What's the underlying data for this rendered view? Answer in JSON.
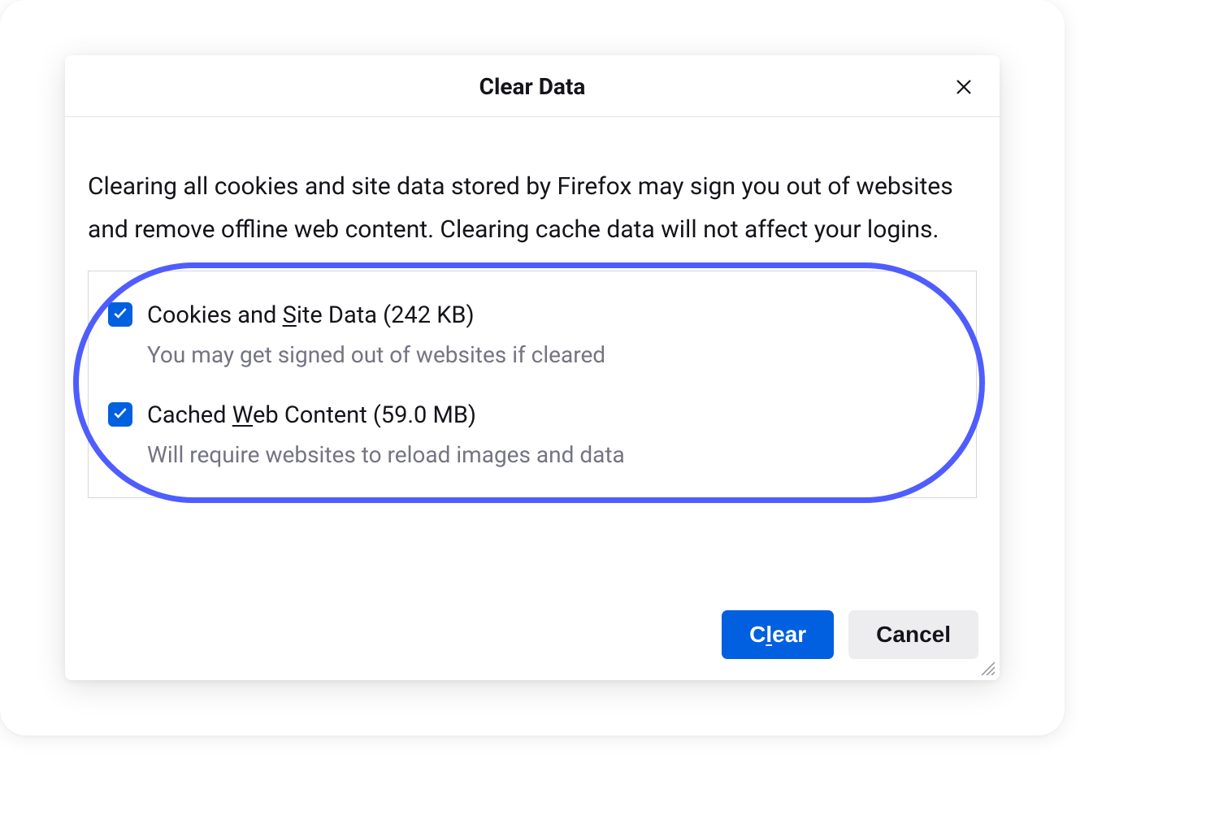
{
  "dialog": {
    "title": "Clear Data",
    "description": "Clearing all cookies and site data stored by Firefox may sign you out of websites and remove offline web content. Clearing cache data will not affect your logins.",
    "options": [
      {
        "checked": true,
        "label_pre": "Cookies and ",
        "label_ul": "S",
        "label_post": "ite Data (242 KB)",
        "sub": "You may get signed out of websites if cleared"
      },
      {
        "checked": true,
        "label_pre": "Cached ",
        "label_ul": "W",
        "label_post": "eb Content (59.0 MB)",
        "sub": "Will require websites to reload images and data"
      }
    ],
    "buttons": {
      "clear_pre": "C",
      "clear_ul": "l",
      "clear_post": "ear",
      "cancel": "Cancel"
    }
  }
}
